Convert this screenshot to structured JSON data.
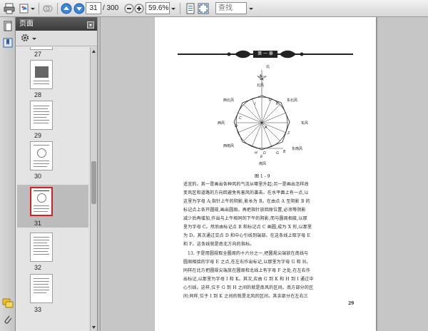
{
  "toolbar": {
    "page_current": "31",
    "page_total": "/ 300",
    "zoom": "59.6%",
    "search_placeholder": "查找"
  },
  "panel": {
    "title": "页面",
    "thumbnails": [
      {
        "label": "27"
      },
      {
        "label": "28"
      },
      {
        "label": "29"
      },
      {
        "label": "30"
      },
      {
        "label": "31"
      },
      {
        "label": "32"
      },
      {
        "label": "33"
      }
    ],
    "selected_index": 4
  },
  "page": {
    "header": "第 一 章",
    "figure": {
      "caption": "图 1 - 9",
      "labels": {
        "north_star": "北",
        "north_wind": "北风",
        "northwest": "西北风",
        "northeast": "东北风",
        "west": "西风",
        "east": "东风",
        "southwest": "西南风",
        "southeast": "东南风",
        "south": "南风",
        "pt_a": "A",
        "pt_b": "B",
        "pt_c": "C",
        "pt_d": "D",
        "pt_e": "E",
        "pt_f": "F",
        "pt_g": "G",
        "pt_h": "H",
        "pt_i": "I",
        "pt_k": "K",
        "pt_o": "O",
        "pt_z": "Z"
      }
    },
    "paragraphs": [
      "适宜的。其一是画出各种风的气流从哪里升起;另一是画出怎样改",
      "变风区和道路的方向回避免有害风的袭击。在水平面上有一点,以",
      "这里为字母 A;指针上午的阴影,影长为 B。在由点 A 至阴影 B 的",
      "标记点上各开圆规,画出圆周。再把指针放回原位置,必须等阴影",
      "减少后再增加,作出与上午相同的下午的阴影,而与圆周相接,以那",
      "里为字母 C。然后由标记点 B 和标记点 C 画圆,成为 X 形,以那里",
      "为 D。其次通过交点 D 和中心引线到端部。在这条线上取字母 E",
      "和 F。这条线就是南北方向的指标。",
      "13. 于是用圆规取全圆周的十六分之一,把圆规尖端放在南线与",
      "圆周相接的字母 E 之点,在左右作出标记,以那里为字母 G 和 H。",
      "同样在北方把圆规尖端放在圆周和北线上有字母 F 之处,在左右作",
      "出标记,以那里为字母 I 和 K。其次,应由 G 到 K 和 H 到 I 通过中",
      "心引线。这样,位于 G 到 H 之间的就是南风的区间。南方部分的区",
      "间;同样,位于 I 到 K 之间的就是北风的区间。其余部分在左右三"
    ],
    "page_number": "29"
  },
  "colors": {
    "selected_border": "#d32020",
    "panel_header": "#4a4a4a"
  }
}
